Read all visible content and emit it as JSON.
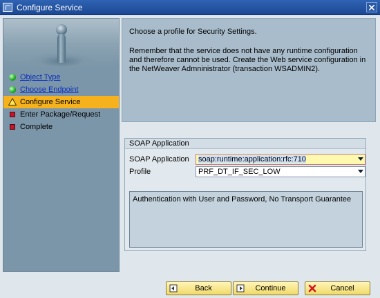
{
  "window": {
    "title": "Configure Service"
  },
  "steps": [
    {
      "label": "Object Type",
      "state": "done"
    },
    {
      "label": "Choose Endpoint",
      "state": "done"
    },
    {
      "label": "Configure Service",
      "state": "active"
    },
    {
      "label": "Enter Package/Request",
      "state": "todo"
    },
    {
      "label": "Complete",
      "state": "todo"
    }
  ],
  "info": {
    "line1": "Choose a profile for Security Settings.",
    "line2": "Remember that the service does not have any runtime configuration and therefore cannot be used. Create the Web service configuration in the NetWeaver Admninistrator (transaction WSADMIN2)."
  },
  "soap": {
    "group_title": "SOAP Application",
    "app_label": "SOAP Application",
    "app_value": "soap:runtime:application:rfc:710",
    "profile_label": "Profile",
    "profile_value": "PRF_DT_IF_SEC_LOW",
    "description": "Authentication with User and Password, No Transport Guarantee"
  },
  "buttons": {
    "back": "Back",
    "continue": "Continue",
    "cancel": "Cancel"
  },
  "colors": {
    "titlebar": "#1c4894",
    "active_step": "#f5b21d",
    "button": "#f1d968"
  }
}
